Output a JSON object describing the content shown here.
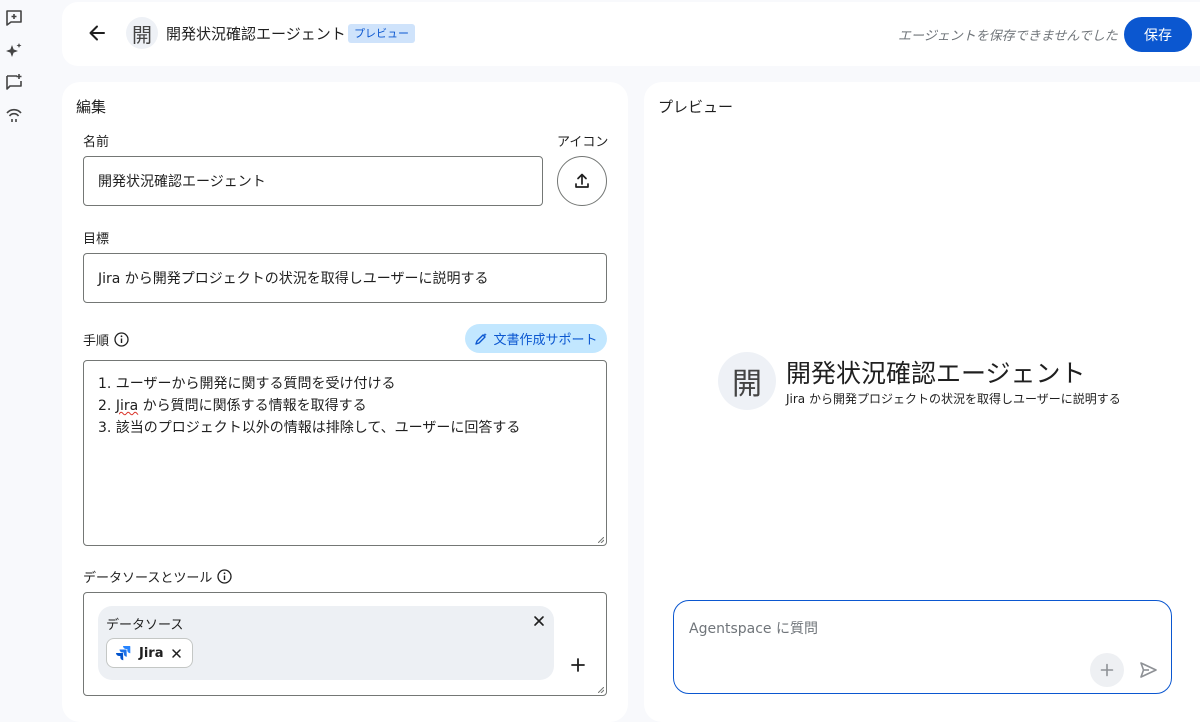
{
  "header": {
    "avatar_char": "開",
    "title": "開発状況確認エージェント",
    "badge": "プレビュー",
    "save_status": "エージェントを保存できませんでした",
    "save_label": "保存"
  },
  "edit": {
    "heading": "編集",
    "name_label": "名前",
    "icon_label": "アイコン",
    "name_value": "開発状況確認エージェント",
    "goal_label": "目標",
    "goal_value": "Jira から開発プロジェクトの状況を取得しユーザーに説明する",
    "steps_label": "手順",
    "assist_label": "文書作成サポート",
    "steps": [
      {
        "prefix": "1. ユーザーから開発に関する質問を受け付ける",
        "wavy": "",
        "suffix": ""
      },
      {
        "prefix": "2. ",
        "wavy": "Jira",
        "suffix": " から質問に関係する情報を取得する"
      },
      {
        "prefix": "3. 該当のプロジェクト以外の情報は排除して、ユーザーに回答する",
        "wavy": "",
        "suffix": ""
      }
    ],
    "ds_tools_label": "データソースとツール",
    "ds_card_title": "データソース",
    "ds_chip_label": "Jira"
  },
  "preview": {
    "heading": "プレビュー",
    "avatar_char": "開",
    "name": "開発状況確認エージェント",
    "goal": "Jira から開発プロジェクトの状況を取得しユーザーに説明する",
    "chat_placeholder": "Agentspace に質問"
  },
  "colors": {
    "accent": "#0b57d0",
    "accent_soft": "#c2e7ff",
    "badge_bg": "#cfe3fb",
    "page_bg": "#f8f9fc"
  },
  "icons": [
    "new-chat-icon",
    "sparkle-icon",
    "feedback-icon",
    "broadcast-icon",
    "back-arrow-icon",
    "upload-icon",
    "info-icon",
    "pen-sparkle-icon",
    "close-icon",
    "jira-logo-icon",
    "plus-icon",
    "send-icon"
  ]
}
